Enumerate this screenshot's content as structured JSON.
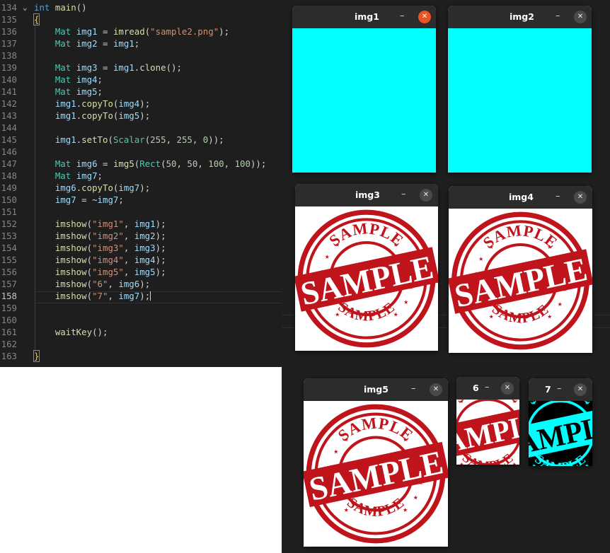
{
  "editor": {
    "lines": [
      {
        "num": "134",
        "fold": "⌄",
        "tokens": [
          [
            "k",
            "int"
          ],
          [
            "p",
            " "
          ],
          [
            "f",
            "main"
          ],
          [
            "p",
            "()"
          ]
        ]
      },
      {
        "num": "135",
        "tokens": [
          [
            "bracket",
            "{"
          ]
        ]
      },
      {
        "num": "136",
        "tokens": [
          [
            "p",
            "    "
          ],
          [
            "t",
            "Mat"
          ],
          [
            "p",
            " "
          ],
          [
            "v",
            "img1"
          ],
          [
            "p",
            " = "
          ],
          [
            "f",
            "imread"
          ],
          [
            "p",
            "("
          ],
          [
            "s",
            "\"sample2.png\""
          ],
          [
            "p",
            ");"
          ]
        ]
      },
      {
        "num": "137",
        "tokens": [
          [
            "p",
            "    "
          ],
          [
            "t",
            "Mat"
          ],
          [
            "p",
            " "
          ],
          [
            "v",
            "img2"
          ],
          [
            "p",
            " = "
          ],
          [
            "v",
            "img1"
          ],
          [
            "p",
            ";"
          ]
        ]
      },
      {
        "num": "138",
        "tokens": []
      },
      {
        "num": "139",
        "tokens": [
          [
            "p",
            "    "
          ],
          [
            "t",
            "Mat"
          ],
          [
            "p",
            " "
          ],
          [
            "v",
            "img3"
          ],
          [
            "p",
            " = "
          ],
          [
            "v",
            "img1"
          ],
          [
            "p",
            "."
          ],
          [
            "f",
            "clone"
          ],
          [
            "p",
            "();"
          ]
        ]
      },
      {
        "num": "140",
        "tokens": [
          [
            "p",
            "    "
          ],
          [
            "t",
            "Mat"
          ],
          [
            "p",
            " "
          ],
          [
            "v",
            "img4"
          ],
          [
            "p",
            ";"
          ]
        ]
      },
      {
        "num": "141",
        "tokens": [
          [
            "p",
            "    "
          ],
          [
            "t",
            "Mat"
          ],
          [
            "p",
            " "
          ],
          [
            "v",
            "img5"
          ],
          [
            "p",
            ";"
          ]
        ]
      },
      {
        "num": "142",
        "tokens": [
          [
            "p",
            "    "
          ],
          [
            "v",
            "img1"
          ],
          [
            "p",
            "."
          ],
          [
            "f",
            "copyTo"
          ],
          [
            "p",
            "("
          ],
          [
            "v",
            "img4"
          ],
          [
            "p",
            ");"
          ]
        ]
      },
      {
        "num": "143",
        "tokens": [
          [
            "p",
            "    "
          ],
          [
            "v",
            "img1"
          ],
          [
            "p",
            "."
          ],
          [
            "f",
            "copyTo"
          ],
          [
            "p",
            "("
          ],
          [
            "v",
            "img5"
          ],
          [
            "p",
            ");"
          ]
        ]
      },
      {
        "num": "144",
        "tokens": []
      },
      {
        "num": "145",
        "tokens": [
          [
            "p",
            "    "
          ],
          [
            "v",
            "img1"
          ],
          [
            "p",
            "."
          ],
          [
            "f",
            "setTo"
          ],
          [
            "p",
            "("
          ],
          [
            "t",
            "Scalar"
          ],
          [
            "p",
            "("
          ],
          [
            "n",
            "255"
          ],
          [
            "p",
            ", "
          ],
          [
            "n",
            "255"
          ],
          [
            "p",
            ", "
          ],
          [
            "n",
            "0"
          ],
          [
            "p",
            "));"
          ]
        ]
      },
      {
        "num": "146",
        "tokens": []
      },
      {
        "num": "147",
        "tokens": [
          [
            "p",
            "    "
          ],
          [
            "t",
            "Mat"
          ],
          [
            "p",
            " "
          ],
          [
            "v",
            "img6"
          ],
          [
            "p",
            " = "
          ],
          [
            "f",
            "img5"
          ],
          [
            "p",
            "("
          ],
          [
            "t",
            "Rect"
          ],
          [
            "p",
            "("
          ],
          [
            "n",
            "50"
          ],
          [
            "p",
            ", "
          ],
          [
            "n",
            "50"
          ],
          [
            "p",
            ", "
          ],
          [
            "n",
            "100"
          ],
          [
            "p",
            ", "
          ],
          [
            "n",
            "100"
          ],
          [
            "p",
            "));"
          ]
        ]
      },
      {
        "num": "148",
        "tokens": [
          [
            "p",
            "    "
          ],
          [
            "t",
            "Mat"
          ],
          [
            "p",
            " "
          ],
          [
            "v",
            "img7"
          ],
          [
            "p",
            ";"
          ]
        ]
      },
      {
        "num": "149",
        "tokens": [
          [
            "p",
            "    "
          ],
          [
            "v",
            "img6"
          ],
          [
            "p",
            "."
          ],
          [
            "f",
            "copyTo"
          ],
          [
            "p",
            "("
          ],
          [
            "v",
            "img7"
          ],
          [
            "p",
            ");"
          ]
        ]
      },
      {
        "num": "150",
        "tokens": [
          [
            "p",
            "    "
          ],
          [
            "v",
            "img7"
          ],
          [
            "p",
            " = ~"
          ],
          [
            "v",
            "img7"
          ],
          [
            "p",
            ";"
          ]
        ]
      },
      {
        "num": "151",
        "tokens": []
      },
      {
        "num": "152",
        "tokens": [
          [
            "p",
            "    "
          ],
          [
            "f",
            "imshow"
          ],
          [
            "p",
            "("
          ],
          [
            "s",
            "\"img1\""
          ],
          [
            "p",
            ", "
          ],
          [
            "v",
            "img1"
          ],
          [
            "p",
            ");"
          ]
        ]
      },
      {
        "num": "153",
        "tokens": [
          [
            "p",
            "    "
          ],
          [
            "f",
            "imshow"
          ],
          [
            "p",
            "("
          ],
          [
            "s",
            "\"img2\""
          ],
          [
            "p",
            ", "
          ],
          [
            "v",
            "img2"
          ],
          [
            "p",
            ");"
          ]
        ]
      },
      {
        "num": "154",
        "tokens": [
          [
            "p",
            "    "
          ],
          [
            "f",
            "imshow"
          ],
          [
            "p",
            "("
          ],
          [
            "s",
            "\"img3\""
          ],
          [
            "p",
            ", "
          ],
          [
            "v",
            "img3"
          ],
          [
            "p",
            ");"
          ]
        ]
      },
      {
        "num": "155",
        "tokens": [
          [
            "p",
            "    "
          ],
          [
            "f",
            "imshow"
          ],
          [
            "p",
            "("
          ],
          [
            "s",
            "\"img4\""
          ],
          [
            "p",
            ", "
          ],
          [
            "v",
            "img4"
          ],
          [
            "p",
            ");"
          ]
        ]
      },
      {
        "num": "156",
        "tokens": [
          [
            "p",
            "    "
          ],
          [
            "f",
            "imshow"
          ],
          [
            "p",
            "("
          ],
          [
            "s",
            "\"img5\""
          ],
          [
            "p",
            ", "
          ],
          [
            "v",
            "img5"
          ],
          [
            "p",
            ");"
          ]
        ]
      },
      {
        "num": "157",
        "tokens": [
          [
            "p",
            "    "
          ],
          [
            "f",
            "imshow"
          ],
          [
            "p",
            "("
          ],
          [
            "s",
            "\"6\""
          ],
          [
            "p",
            ", "
          ],
          [
            "v",
            "img6"
          ],
          [
            "p",
            ");"
          ]
        ]
      },
      {
        "num": "158",
        "current": true,
        "tokens": [
          [
            "p",
            "    "
          ],
          [
            "f",
            "imshow"
          ],
          [
            "p",
            "("
          ],
          [
            "s",
            "\"7\""
          ],
          [
            "p",
            ", "
          ],
          [
            "v",
            "img7"
          ],
          [
            "p",
            ");"
          ]
        ]
      },
      {
        "num": "159",
        "tokens": []
      },
      {
        "num": "160",
        "tokens": []
      },
      {
        "num": "161",
        "tokens": [
          [
            "p",
            "    "
          ],
          [
            "f",
            "waitKey"
          ],
          [
            "p",
            "();"
          ]
        ]
      },
      {
        "num": "162",
        "tokens": []
      },
      {
        "num": "163",
        "tokens": [
          [
            "bracket",
            "}"
          ]
        ]
      }
    ]
  },
  "windows": {
    "img1": {
      "title": "img1",
      "minimize": "–",
      "close": "✕"
    },
    "img2": {
      "title": "img2",
      "minimize": "–",
      "close": "✕"
    },
    "img3": {
      "title": "img3",
      "minimize": "–",
      "close": "✕"
    },
    "img4": {
      "title": "img4",
      "minimize": "–",
      "close": "✕"
    },
    "img5": {
      "title": "img5",
      "minimize": "–",
      "close": "✕"
    },
    "w6": {
      "title": "6",
      "minimize": "–",
      "close": "✕"
    },
    "w7": {
      "title": "7",
      "minimize": "–",
      "close": "✕"
    }
  },
  "stamp": {
    "top_text": "SAMPLE",
    "main_text": "SAMPLE",
    "bottom_text": "SAMPLE",
    "star": "★",
    "ink_color": "#c0141c",
    "inverted_color": "#00ffff"
  },
  "colors": {
    "editor_bg": "#1e1e1e",
    "desktop_bg": "#1f1f1f",
    "titlebar_bg": "#2c2c2c",
    "active_close": "#e95420",
    "fill_cyan": "#00ffff"
  }
}
